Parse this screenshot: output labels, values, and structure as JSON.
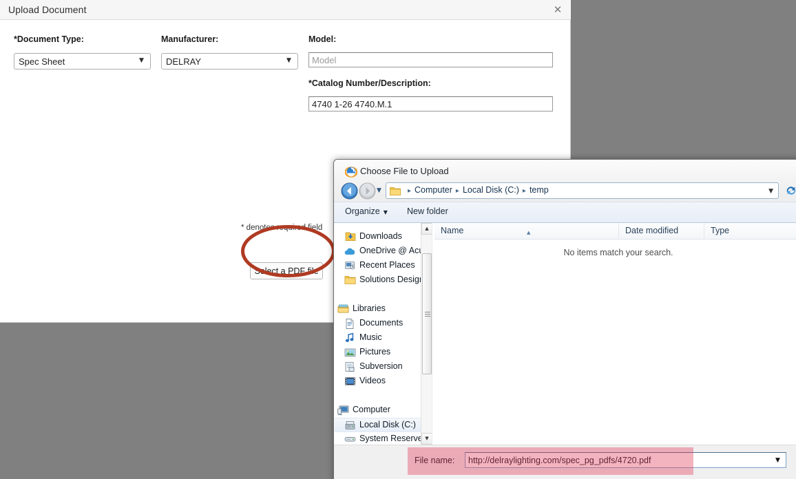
{
  "upload_dialog": {
    "title": "Upload Document",
    "close_icon": "close-icon",
    "fields": {
      "document_type_label": "*Document Type:",
      "document_type_value": "Spec Sheet",
      "document_type_options": [
        "Spec Sheet"
      ],
      "manufacturer_label": "Manufacturer:",
      "manufacturer_value": "DELRAY",
      "manufacturer_options": [
        "DELRAY"
      ],
      "model_label": "Model:",
      "model_value": "",
      "model_placeholder": "Model",
      "catalog_label": "*Catalog Number/Description:",
      "catalog_value": "4740 1-26 4740.M.1"
    },
    "required_note": "* denotes required field",
    "select_pdf_button": "Select a PDF file"
  },
  "file_dialog": {
    "title": "Choose File to Upload",
    "app_icon": "internet-explorer-icon",
    "nav": {
      "back_icon": "back-arrow-icon",
      "forward_icon": "forward-arrow-icon",
      "recent_icon": "recent-pages-caret-icon",
      "folder_icon": "folder-icon",
      "breadcrumbs": [
        "Computer",
        "Local Disk (C:)",
        "temp"
      ],
      "breadcrumb_separator": "▸",
      "address_caret": "▼",
      "refresh_icon": "refresh-icon"
    },
    "toolbar": {
      "organize_label": "Organize",
      "organize_caret": "▼",
      "new_folder_label": "New folder"
    },
    "nav_pane": {
      "items": [
        {
          "label": "Downloads",
          "icon": "downloads-icon",
          "indent": "child",
          "selected": false
        },
        {
          "label": "OneDrive @ Acui",
          "icon": "onedrive-icon",
          "indent": "child",
          "selected": false
        },
        {
          "label": "Recent Places",
          "icon": "recent-places-icon",
          "indent": "child",
          "selected": false
        },
        {
          "label": "Solutions Design",
          "icon": "folder-icon",
          "indent": "child",
          "selected": false
        },
        {
          "label": "Libraries",
          "icon": "libraries-icon",
          "indent": "root",
          "selected": false
        },
        {
          "label": "Documents",
          "icon": "documents-icon",
          "indent": "child",
          "selected": false
        },
        {
          "label": "Music",
          "icon": "music-icon",
          "indent": "child",
          "selected": false
        },
        {
          "label": "Pictures",
          "icon": "pictures-icon",
          "indent": "child",
          "selected": false
        },
        {
          "label": "Subversion",
          "icon": "subversion-icon",
          "indent": "child",
          "selected": false
        },
        {
          "label": "Videos",
          "icon": "videos-icon",
          "indent": "child",
          "selected": false
        },
        {
          "label": "Computer",
          "icon": "computer-icon",
          "indent": "root",
          "selected": false
        },
        {
          "label": "Local Disk (C:)",
          "icon": "harddisk-icon",
          "indent": "child",
          "selected": true
        },
        {
          "label": "System Reserved",
          "icon": "drive-icon",
          "indent": "child",
          "selected": false
        }
      ],
      "scroll_up_icon": "▲",
      "scroll_down_icon": "▼"
    },
    "file_list": {
      "columns": [
        {
          "label": "Name",
          "sorted": true
        },
        {
          "label": "Date modified",
          "sorted": false
        },
        {
          "label": "Type",
          "sorted": false
        }
      ],
      "sort_arrow": "▲",
      "empty_message": "No items match your search."
    },
    "footer": {
      "file_name_label": "File name:",
      "file_name_value": "http://delraylighting.com/spec_pg_pdfs/4720.pdf",
      "file_type_caret": "▼"
    }
  },
  "annotations": {
    "ellipse_color": "#b03a22",
    "highlight_color": "#e03a5a",
    "ellipse_target": "select-a-pdf-file-button",
    "highlight_target": "file-name-row"
  },
  "colors": {
    "backdrop": "#808080",
    "panel_bg": "#ffffff",
    "dialog_bg": "#f0f0f0"
  }
}
